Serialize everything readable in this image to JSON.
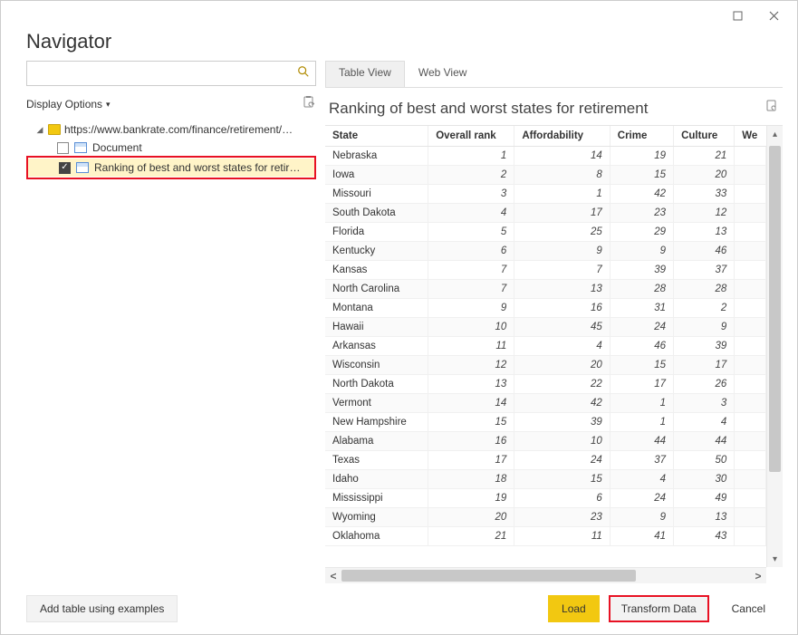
{
  "window": {
    "title": "Navigator"
  },
  "titlebar": {
    "maximize": "▢",
    "close": "✕"
  },
  "search": {
    "placeholder": ""
  },
  "display_options": {
    "label": "Display Options"
  },
  "tree": {
    "root": "https://www.bankrate.com/finance/retirement/…",
    "items": [
      {
        "label": "Document",
        "checked": false
      },
      {
        "label": "Ranking of best and worst states for retire…",
        "checked": true
      }
    ]
  },
  "tabs": {
    "table": "Table View",
    "web": "Web View"
  },
  "preview": {
    "title": "Ranking of best and worst states for retirement",
    "columns": [
      "State",
      "Overall rank",
      "Affordability",
      "Crime",
      "Culture",
      "We"
    ],
    "rows": [
      [
        "Nebraska",
        1,
        14,
        19,
        21
      ],
      [
        "Iowa",
        2,
        8,
        15,
        20
      ],
      [
        "Missouri",
        3,
        1,
        42,
        33
      ],
      [
        "South Dakota",
        4,
        17,
        23,
        12
      ],
      [
        "Florida",
        5,
        25,
        29,
        13
      ],
      [
        "Kentucky",
        6,
        9,
        9,
        46
      ],
      [
        "Kansas",
        7,
        7,
        39,
        37
      ],
      [
        "North Carolina",
        7,
        13,
        28,
        28
      ],
      [
        "Montana",
        9,
        16,
        31,
        2
      ],
      [
        "Hawaii",
        10,
        45,
        24,
        9
      ],
      [
        "Arkansas",
        11,
        4,
        46,
        39
      ],
      [
        "Wisconsin",
        12,
        20,
        15,
        17
      ],
      [
        "North Dakota",
        13,
        22,
        17,
        26
      ],
      [
        "Vermont",
        14,
        42,
        1,
        3
      ],
      [
        "New Hampshire",
        15,
        39,
        1,
        4
      ],
      [
        "Alabama",
        16,
        10,
        44,
        44
      ],
      [
        "Texas",
        17,
        24,
        37,
        50
      ],
      [
        "Idaho",
        18,
        15,
        4,
        30
      ],
      [
        "Mississippi",
        19,
        6,
        24,
        49
      ],
      [
        "Wyoming",
        20,
        23,
        9,
        13
      ],
      [
        "Oklahoma",
        21,
        11,
        41,
        43
      ]
    ]
  },
  "footer": {
    "add_examples": "Add table using examples",
    "load": "Load",
    "transform": "Transform Data",
    "cancel": "Cancel"
  }
}
